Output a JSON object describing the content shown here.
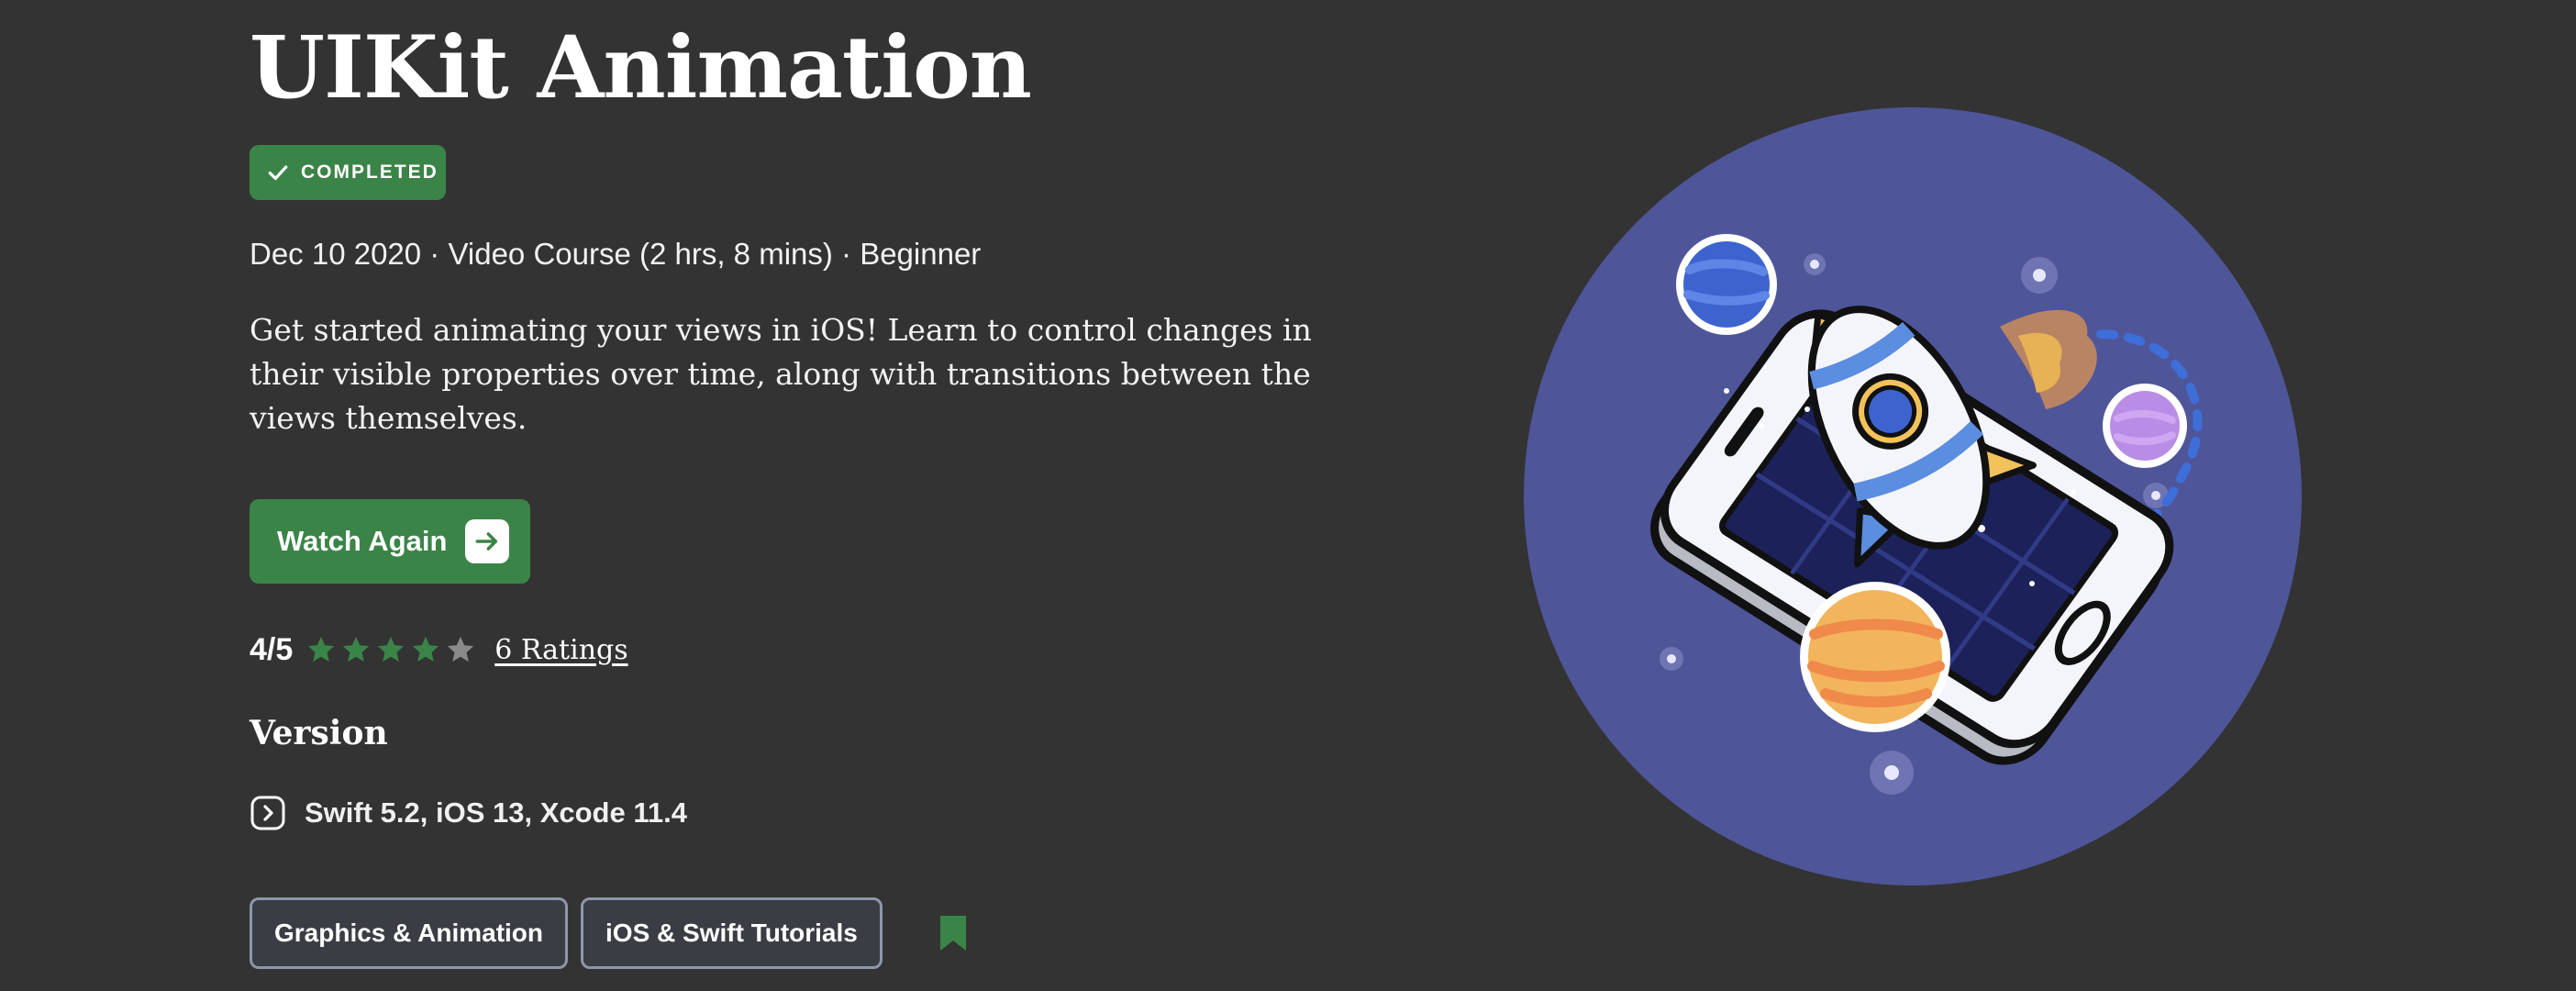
{
  "course": {
    "title": "UIKit Animation",
    "status_badge": "COMPLETED",
    "meta_line": "Dec 10 2020 · Video Course (2 hrs, 8 mins) · Beginner",
    "description": "Get started animating your views in iOS! Learn to control changes in their visible properties over time, along with transitions between the views themselves.",
    "watch_button_label": "Watch Again",
    "rating": {
      "score_text": "4/5",
      "stars_filled": 4,
      "stars_total": 5,
      "ratings_link": "6 Ratings"
    },
    "version": {
      "heading": "Version",
      "text": "Swift 5.2, iOS 13, Xcode 11.4"
    },
    "tags": [
      "Graphics & Animation",
      "iOS & Swift Tutorials"
    ]
  },
  "icons": {
    "badge": "checkmark-icon",
    "watch_button": "arrow-right-icon",
    "version": "chevron-right-icon",
    "bookmark": "bookmark-icon",
    "hero": "rocket-phone-illustration"
  },
  "colors": {
    "background": "#333333",
    "accent_green": "#3b8448",
    "star_empty": "#8a8a8a",
    "tag_border": "#8d97ab",
    "hero_circle": "#4f5599"
  }
}
